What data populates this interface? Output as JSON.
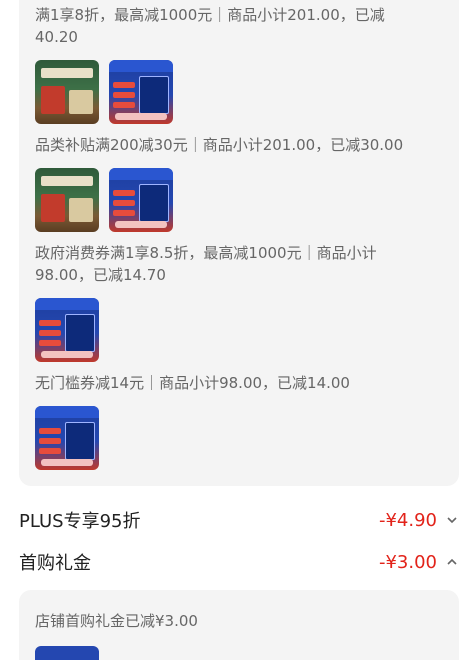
{
  "promotions": [
    {
      "line1": "满1享8折，最高减1000元｜商品小计201.00，已减",
      "line2": "40.20",
      "thumbs": [
        "green",
        "blue"
      ]
    },
    {
      "line1": "品类补贴满200减30元｜商品小计201.00，已减30.00",
      "thumbs": [
        "green",
        "blue"
      ]
    },
    {
      "line1": "政府消费券满1享8.5折，最高减1000元｜商品小计",
      "line2": "98.00，已减14.70",
      "thumbs": [
        "blue"
      ]
    },
    {
      "line1": "无门槛券减14元｜商品小计98.00，已减14.00",
      "thumbs": [
        "blue"
      ]
    }
  ],
  "plus_row": {
    "label": "PLUS专享95折",
    "value": "-¥4.90",
    "icon": "chevron-down-icon"
  },
  "first_gift_row": {
    "label": "首购礼金",
    "value": "-¥3.00",
    "icon": "chevron-up-icon"
  },
  "first_gift_detail": {
    "text": "店铺首购礼金已减¥3.00"
  },
  "colors": {
    "price_red": "#e2231a",
    "panel_bg": "#f4f4f4"
  }
}
